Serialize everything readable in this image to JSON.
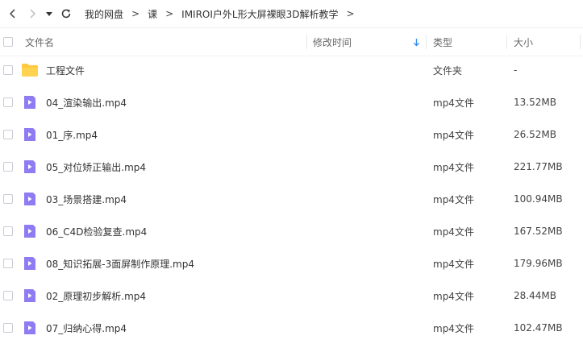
{
  "nav": {
    "back_icon": "chevron-left-icon",
    "forward_icon": "chevron-right-icon",
    "dropdown_icon": "caret-down-icon",
    "refresh_icon": "refresh-icon"
  },
  "breadcrumb": {
    "items": [
      "我的网盘",
      "课",
      "IMIROI户外L形大屏裸眼3D解析教学"
    ],
    "separator": ">"
  },
  "columns": {
    "name": "文件名",
    "modified": "修改时间",
    "type": "类型",
    "size": "大小",
    "sort_icon": "arrow-down-icon"
  },
  "colors": {
    "accent": "#3b8cf6",
    "folder": "#ffc93f",
    "video": "#8f7cf2"
  },
  "files": [
    {
      "name": "工程文件",
      "type": "文件夹",
      "size": "-",
      "icon": "folder-icon"
    },
    {
      "name": "04_渲染输出.mp4",
      "type": "mp4文件",
      "size": "13.52MB",
      "icon": "video-file-icon"
    },
    {
      "name": "01_序.mp4",
      "type": "mp4文件",
      "size": "26.52MB",
      "icon": "video-file-icon"
    },
    {
      "name": "05_对位矫正输出.mp4",
      "type": "mp4文件",
      "size": "221.77MB",
      "icon": "video-file-icon"
    },
    {
      "name": "03_场景搭建.mp4",
      "type": "mp4文件",
      "size": "100.94MB",
      "icon": "video-file-icon"
    },
    {
      "name": "06_C4D检验复查.mp4",
      "type": "mp4文件",
      "size": "167.52MB",
      "icon": "video-file-icon"
    },
    {
      "name": "08_知识拓展-3面屏制作原理.mp4",
      "type": "mp4文件",
      "size": "179.96MB",
      "icon": "video-file-icon"
    },
    {
      "name": "02_原理初步解析.mp4",
      "type": "mp4文件",
      "size": "28.44MB",
      "icon": "video-file-icon"
    },
    {
      "name": "07_归纳心得.mp4",
      "type": "mp4文件",
      "size": "102.47MB",
      "icon": "video-file-icon"
    }
  ]
}
